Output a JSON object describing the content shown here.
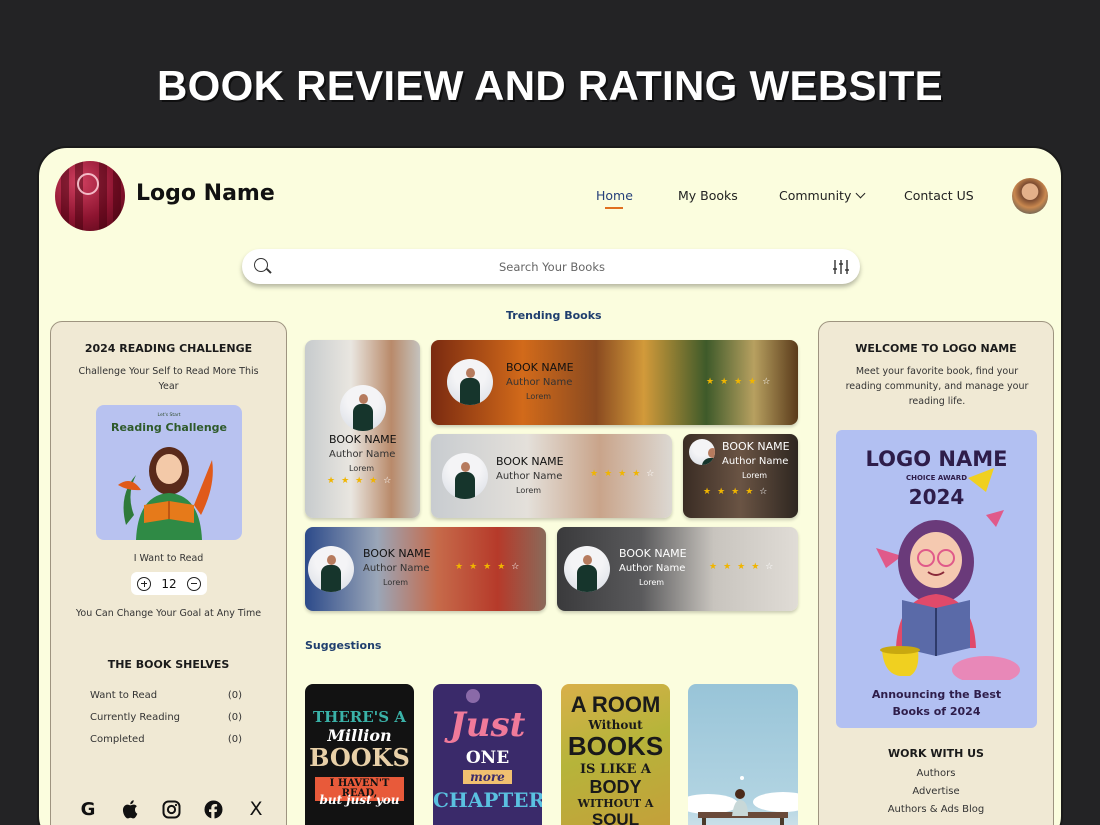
{
  "page": {
    "heading": "BOOK REVIEW AND RATING WEBSITE"
  },
  "header": {
    "logo_name": "Logo Name",
    "nav": {
      "home": "Home",
      "my_books": "My Books",
      "community": "Community",
      "contact": "Contact US"
    }
  },
  "search": {
    "placeholder": "Search Your Books"
  },
  "challenge": {
    "title": "2024 READING CHALLENGE",
    "subtitle": "Challenge Your Self to Read More This Year",
    "image_small": "Let's Start",
    "image_title": "Reading Challenge",
    "want_label": "I Want to Read",
    "goal": "12",
    "change_text": "You Can Change Your Goal at Any Time"
  },
  "shelves": {
    "title": "THE BOOK SHELVES",
    "items": [
      {
        "label": "Want to Read",
        "count": "(0)"
      },
      {
        "label": "Currently Reading",
        "count": "(0)"
      },
      {
        "label": "Completed",
        "count": "(0)"
      }
    ]
  },
  "socials": {
    "google": "G",
    "apple": "",
    "instagram": "◎",
    "facebook": "f",
    "x": "X"
  },
  "trending": {
    "title": "Trending Books",
    "book_name": "BOOK NAME",
    "author": "Author Name",
    "lorem": "Lorem",
    "rating": 4,
    "max_rating": 5
  },
  "suggestions": {
    "title": "Suggestions",
    "covers": [
      {
        "lines": [
          "THERE'S A",
          "Million",
          "BOOKS",
          "I HAVEN'T READ,",
          "but just you"
        ]
      },
      {
        "lines": [
          "Just",
          "ONE",
          "more",
          "CHAPTER"
        ]
      },
      {
        "lines": [
          "A ROOM",
          "Without",
          "BOOKS",
          "IS LIKE A",
          "BODY",
          "WITHOUT A",
          "SOUL"
        ]
      },
      {
        "lines": []
      }
    ]
  },
  "welcome": {
    "title": "WELCOME TO LOGO NAME",
    "text": "Meet your favorite book, find your reading community, and manage your reading life."
  },
  "award": {
    "logo": "LOGO NAME",
    "choice": "CHOICE AWARD",
    "year": "2024",
    "announcement_1": "Announcing the Best",
    "announcement_2": "Books of 2024"
  },
  "work": {
    "title": "WORK WITH US",
    "links": [
      "Authors",
      "Advertise",
      "Authors & Ads Blog"
    ]
  },
  "colors": {
    "frame_bg": "#fbfdde",
    "card_bg": "#f0e9d4",
    "accent": "#e07020",
    "star": "#f0b500",
    "section_title": "#1f3e6e"
  }
}
